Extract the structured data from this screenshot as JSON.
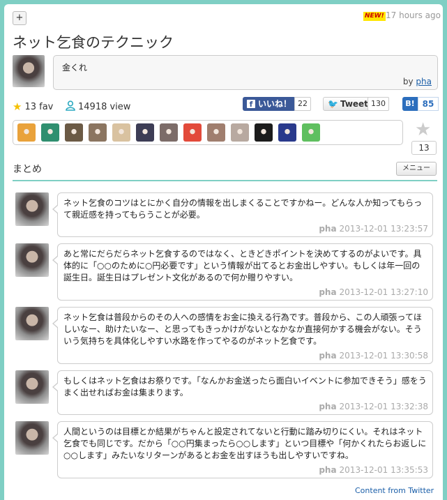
{
  "header": {
    "plus_label": "+",
    "new_badge": "NEW!",
    "time_ago": "17 hours ago",
    "title": "ネット乞食のテクニック"
  },
  "description": {
    "text": "金くれ",
    "by_prefix": "by",
    "author": "pha"
  },
  "stats": {
    "fav_count": "13 fav",
    "view_count": "14918 view"
  },
  "share": {
    "facebook_label": "いいね！",
    "facebook_count": "22",
    "tweet_label": "Tweet",
    "tweet_count": "130",
    "hatena_label": "B!",
    "hatena_count": "85"
  },
  "favorites": {
    "count": "13",
    "avatars": [
      {
        "name": "fav-avatar-1",
        "color": "#e9a23b"
      },
      {
        "name": "fav-avatar-2",
        "color": "#2f8f6f"
      },
      {
        "name": "fav-avatar-3",
        "color": "#6b5a45"
      },
      {
        "name": "fav-avatar-4",
        "color": "#8b7560"
      },
      {
        "name": "fav-avatar-5",
        "color": "#d9c2a0"
      },
      {
        "name": "fav-avatar-6",
        "color": "#3d3d55"
      },
      {
        "name": "fav-avatar-7",
        "color": "#7c6c68"
      },
      {
        "name": "fav-avatar-8",
        "color": "#e24a3a"
      },
      {
        "name": "fav-avatar-9",
        "color": "#a07e6e"
      },
      {
        "name": "fav-avatar-10",
        "color": "#b8a9a0"
      },
      {
        "name": "fav-avatar-11",
        "color": "#1c1c1c"
      },
      {
        "name": "fav-avatar-12",
        "color": "#2a3a8c"
      },
      {
        "name": "fav-avatar-13",
        "color": "#5fbf5f"
      }
    ]
  },
  "section": {
    "title": "まとめ",
    "menu_label": "メニュー"
  },
  "tweets": [
    {
      "text": "ネット乞食のコツはとにかく自分の情報を出しまくることですかねー。どんな人か知ってもらって親近感を持ってもらうことが必要。",
      "user": "pha",
      "timestamp": "2013-12-01 13:23:57"
    },
    {
      "text": "あと常にだらだらネット乞食するのではなく、ときどきポイントを決めてするのがよいです。具体的に「○○のために○円必要です」という情報が出てるとお金出しやすい。もしくは年一回の誕生日。誕生日はプレゼント文化があるので何か贈りやすい。",
      "user": "pha",
      "timestamp": "2013-12-01 13:27:10"
    },
    {
      "text": "ネット乞食は普段からのその人への感情をお金に換える行為です。普段から、この人頑張ってほしいなー、助けたいなー、と思ってもきっかけがないとなかなか直接何かする機会がない。そういう気持ちを具体化しやすい水路を作ってやるのがネット乞食です。",
      "user": "pha",
      "timestamp": "2013-12-01 13:30:58"
    },
    {
      "text": "もしくはネット乞食はお祭りです。「なんかお金送ったら面白いイベントに参加できそう」感をうまく出せればお金は集まります。",
      "user": "pha",
      "timestamp": "2013-12-01 13:32:38"
    },
    {
      "text": "人間というのは目標とか結果がちゃんと設定されてないと行動に踏み切りにくい。それはネット乞食でも同じです。だから「○○円集まったら○○します」といつ目標や「何かくれたらお返しに○○します」みたいなリターンがあるとお金を出すほうも出しやすいですね。",
      "user": "pha",
      "timestamp": "2013-12-01 13:35:53"
    }
  ],
  "footer": {
    "content_from": "Content from Twitter"
  }
}
